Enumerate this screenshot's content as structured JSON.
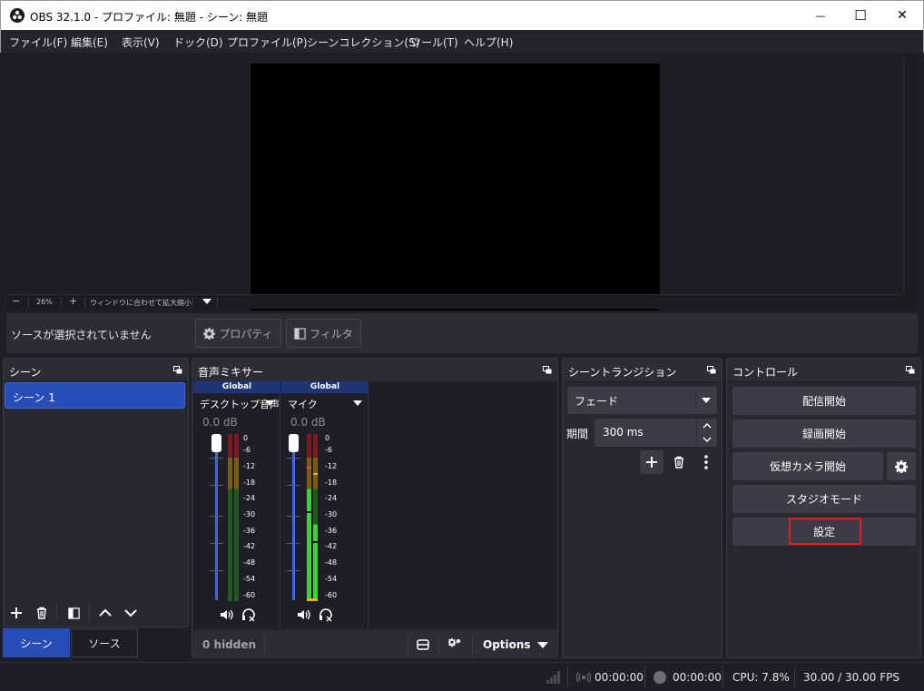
{
  "window": {
    "title": "OBS 32.1.0 - プロファイル: 無題 - シーン: 無題",
    "minimize": "—",
    "maximize": "☐",
    "close": "✕"
  },
  "menu": [
    "ファイル(F)",
    "編集(E)",
    "表示(V)",
    "ドック(D)",
    "プロファイル(P)",
    "シーンコレクション(S)",
    "ツール(T)",
    "ヘルプ(H)"
  ],
  "zoom": {
    "minus": "−",
    "level": "26%",
    "plus": "+",
    "fit_label": "ウィンドウに合わせて拡大縮小"
  },
  "source_bar": {
    "no_source": "ソースが選択されていません",
    "properties": "プロパティ",
    "filters": "フィルタ"
  },
  "scenes": {
    "title": "シーン",
    "items": [
      "シーン 1"
    ]
  },
  "tabs": {
    "scenes": "シーン",
    "sources": "ソース"
  },
  "mixer": {
    "title": "音声ミキサー",
    "channels": [
      {
        "group": "Global",
        "name": "デスクトップ音声",
        "db": "0.0 dB"
      },
      {
        "group": "Global",
        "name": "マイク",
        "db": "0.0 dB"
      }
    ],
    "scale": [
      "0",
      "-6",
      "-12",
      "-18",
      "-24",
      "-30",
      "-36",
      "-42",
      "-48",
      "-54",
      "-60"
    ],
    "hidden": "0 hidden",
    "options": "Options"
  },
  "transitions": {
    "title": "シーントランジション",
    "selected": "フェード",
    "duration_label": "期間",
    "duration_value": "300 ms"
  },
  "controls": {
    "title": "コントロール",
    "start_streaming": "配信開始",
    "start_recording": "録画開始",
    "start_virtualcam": "仮想カメラ開始",
    "studio_mode": "スタジオモード",
    "settings": "設定"
  },
  "status": {
    "stream_time": "00:00:00",
    "rec_time": "00:00:00",
    "cpu": "CPU: 7.8%",
    "fps": "30.00 / 30.00 FPS"
  },
  "colors": {
    "accent": "#284cb8",
    "highlight": "#e0201f",
    "meter_green": "#3ecf3e",
    "meter_yellow": "#8a6a10",
    "meter_red": "#7a1a22"
  }
}
